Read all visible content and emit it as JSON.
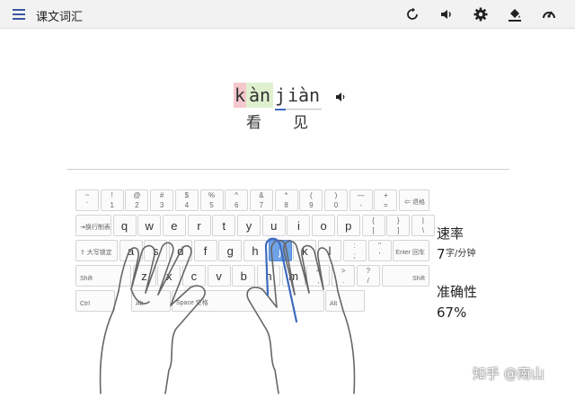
{
  "app": {
    "title": "课文词汇"
  },
  "toolbar": {
    "icons": [
      "menu-icon",
      "restart-icon",
      "volume-icon",
      "settings-icon",
      "theme-fill-icon",
      "speed-gauge-icon"
    ]
  },
  "word": {
    "pinyin": {
      "k": "k",
      "an": "àn",
      "j": "j",
      "ian": "iàn"
    },
    "hanzi": [
      "看",
      "见"
    ],
    "audio_icon": "speaker-icon"
  },
  "keyboard": {
    "row1": [
      {
        "top": "~",
        "main": "`"
      },
      {
        "top": "!",
        "main": "1"
      },
      {
        "top": "@",
        "main": "2"
      },
      {
        "top": "#",
        "main": "3"
      },
      {
        "top": "$",
        "main": "4"
      },
      {
        "top": "%",
        "main": "5"
      },
      {
        "top": "^",
        "main": "6"
      },
      {
        "top": "&",
        "main": "7"
      },
      {
        "top": "*",
        "main": "8"
      },
      {
        "top": "(",
        "main": "9"
      },
      {
        "top": ")",
        "main": "0"
      },
      {
        "top": "—",
        "main": "-"
      },
      {
        "top": "+",
        "main": "="
      }
    ],
    "backspace": "⇐ 退格",
    "tab": "⇥换行制表",
    "row2": [
      "q",
      "w",
      "e",
      "r",
      "t",
      "y",
      "u",
      "i",
      "o",
      "p"
    ],
    "row2_sym": [
      {
        "top": "{",
        "main": "["
      },
      {
        "top": "}",
        "main": "]"
      },
      {
        "top": "|",
        "main": "\\"
      }
    ],
    "caps": "⇪ 大写锁定",
    "row3": [
      "a",
      "s",
      "d",
      "f",
      "g",
      "h",
      "j",
      "k",
      "l"
    ],
    "row3_sym": [
      {
        "top": ":",
        "main": ";"
      },
      {
        "top": "\"",
        "main": "'"
      }
    ],
    "enter": "Enter 回车",
    "shift_left": "Shift",
    "row4": [
      "z",
      "x",
      "c",
      "v",
      "b",
      "n",
      "m"
    ],
    "row4_sym": [
      {
        "top": "<",
        "main": ","
      },
      {
        "top": ">",
        "main": "."
      },
      {
        "top": "?",
        "main": "/"
      }
    ],
    "shift_right": "Shift",
    "ctrl": "Ctrl",
    "alt_left": "Alt",
    "space": "Space 空格",
    "alt_right": "Alt",
    "active_key": "j"
  },
  "stats": {
    "speed_label": "速率",
    "speed_value": "7",
    "speed_unit": "字/分钟",
    "accuracy_label": "准确性",
    "accuracy_value": "67%"
  },
  "watermark": "知乎 @南山",
  "colors": {
    "accent": "#6fa3e8",
    "initial_bg": "#f5c8cc",
    "final_bg": "#dff0cf"
  }
}
